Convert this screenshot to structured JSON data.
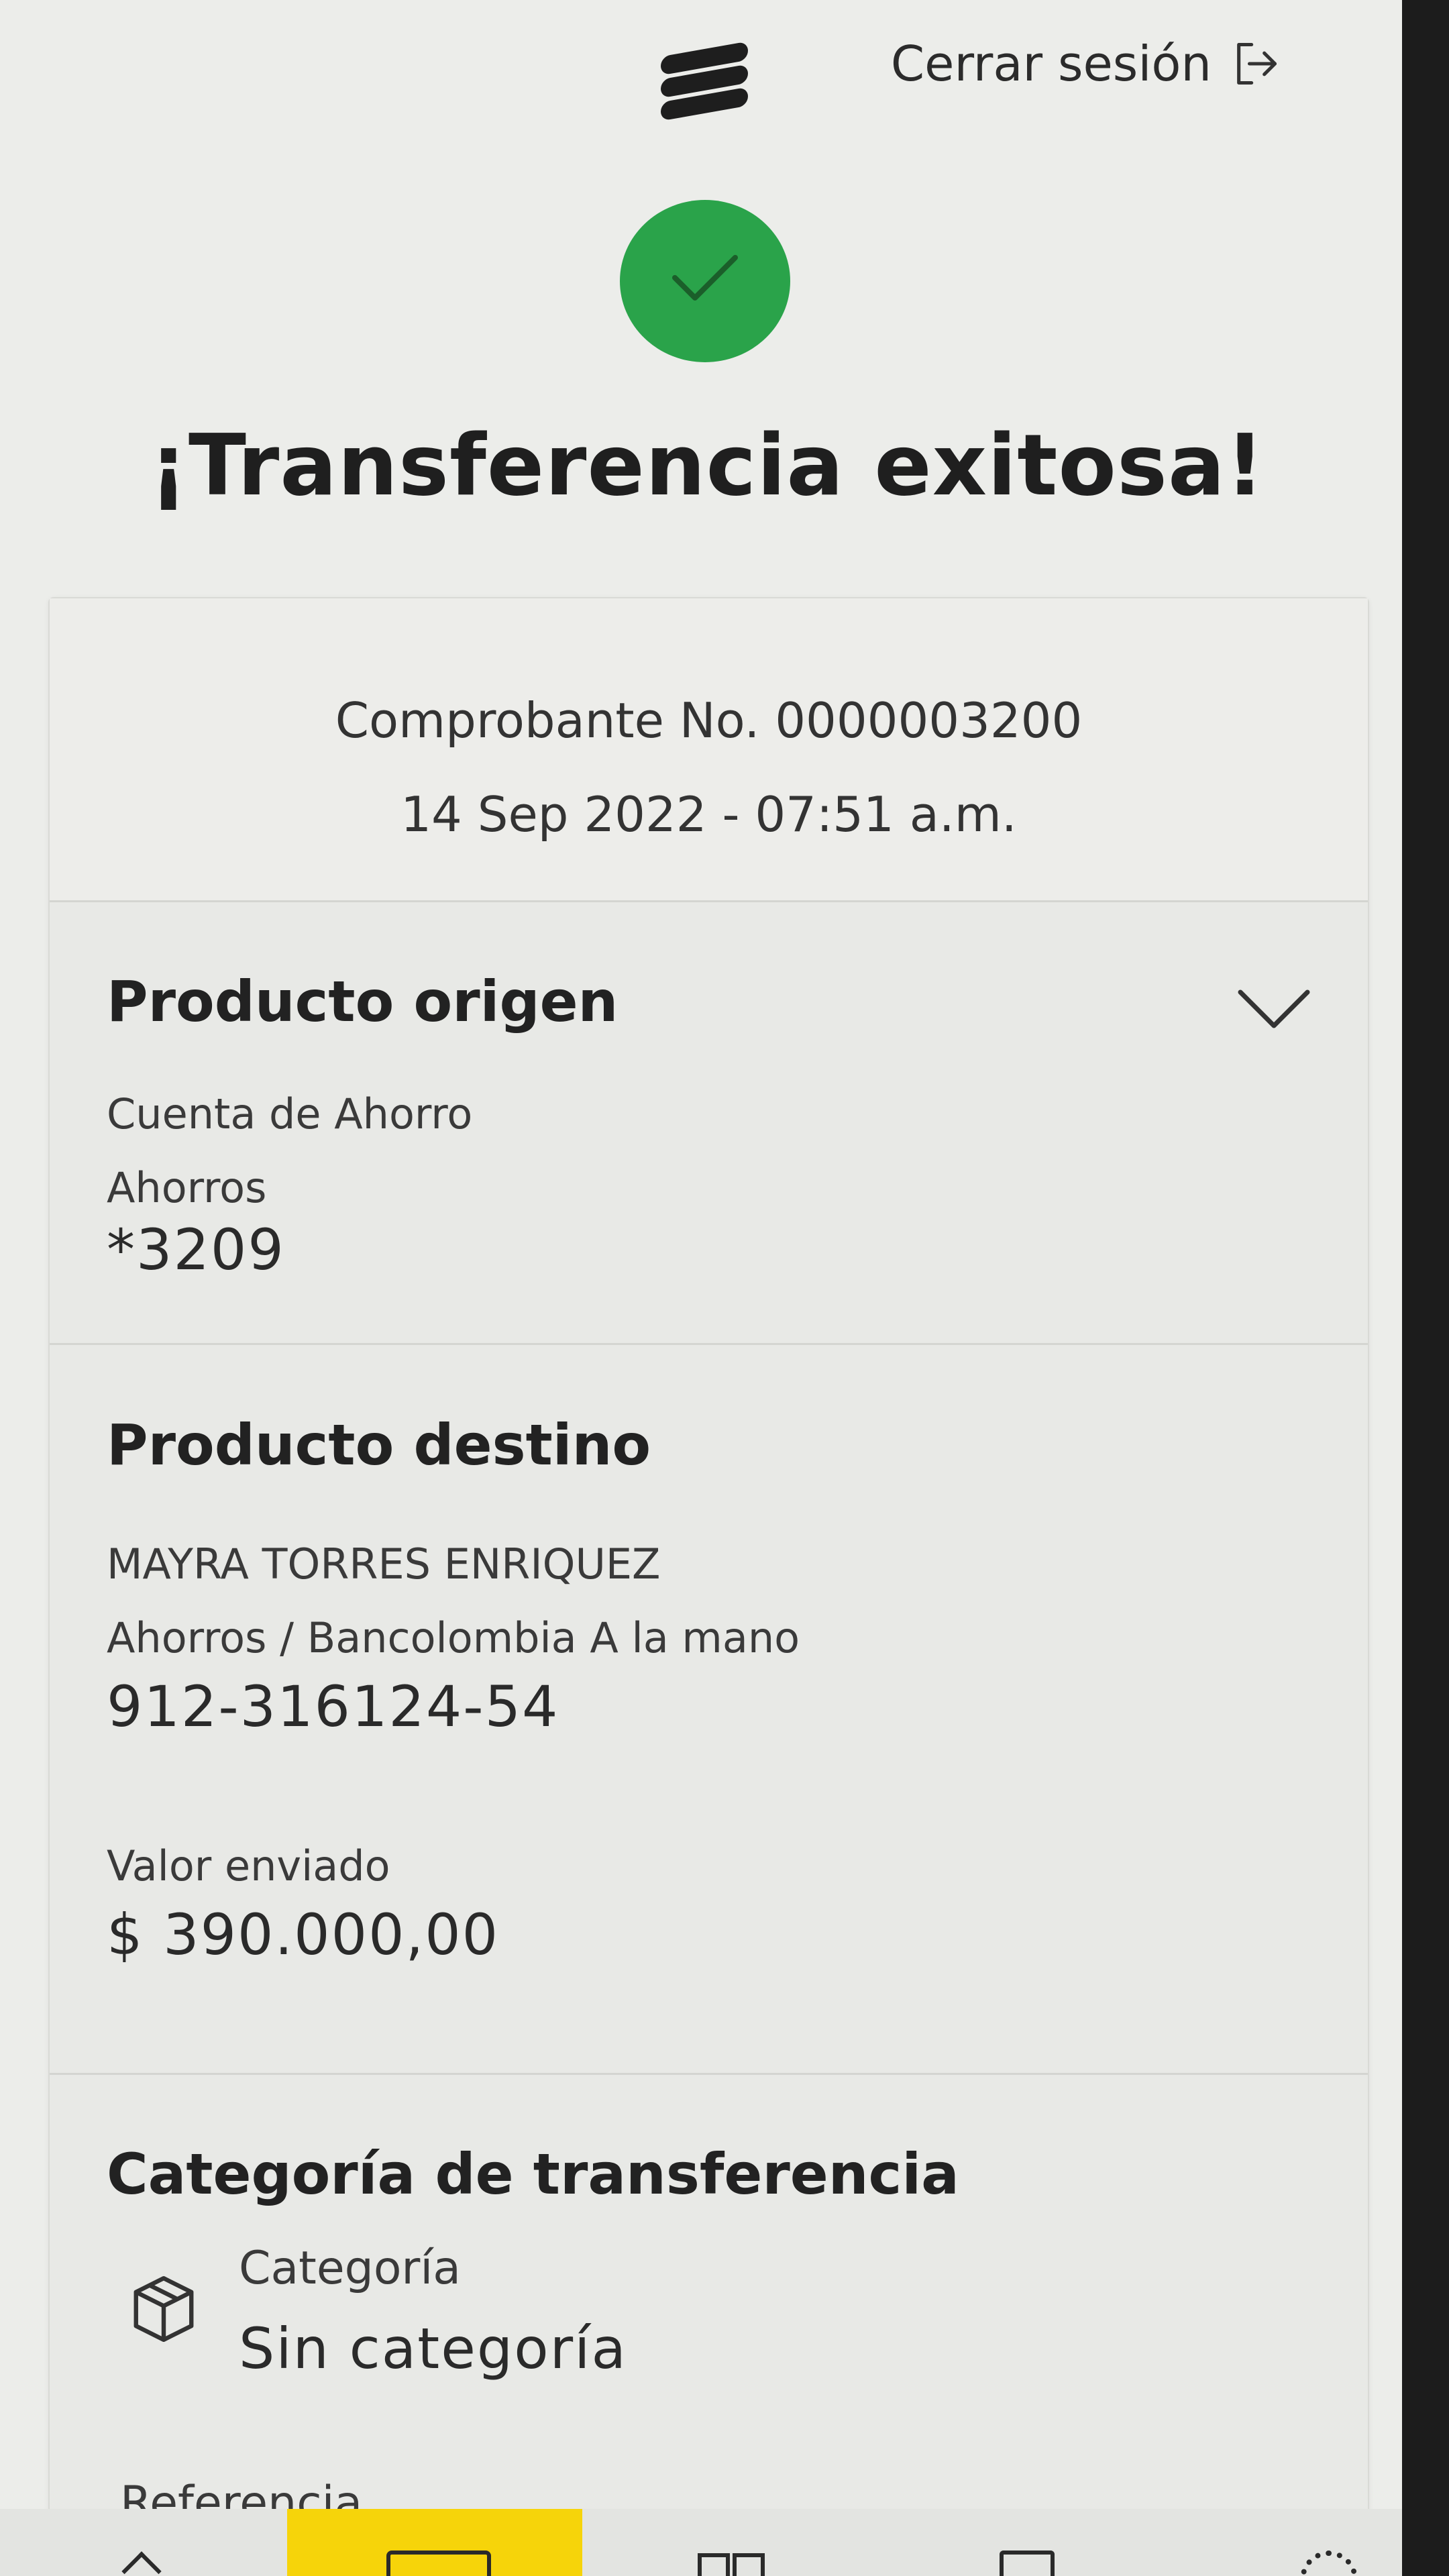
{
  "header": {
    "logout_label": "Cerrar sesión"
  },
  "status": {
    "title": "¡Transferencia exitosa!"
  },
  "receipt": {
    "number": "Comprobante No. 0000003200",
    "date": "14 Sep 2022 - 07:51 a.m."
  },
  "origin": {
    "title": "Producto origen",
    "type": "Cuenta de Ahorro",
    "subtype": "Ahorros",
    "account": "*3209"
  },
  "destination": {
    "title": "Producto destino",
    "name": "MAYRA TORRES ENRIQUEZ",
    "bank": "Ahorros / Bancolombia A la mano",
    "account": "912-316124-54",
    "amount_label": "Valor enviado",
    "amount": "$ 390.000,00"
  },
  "category": {
    "title": "Categoría de transferencia",
    "label": "Categoría",
    "value": "Sin categoría",
    "reference_label": "Referencia"
  },
  "colors": {
    "success": "#2aa34a",
    "accent": "#f6d40a"
  },
  "icons": [
    "logo-icon",
    "logout-icon",
    "check-icon",
    "chevron-down-icon",
    "package-icon"
  ]
}
